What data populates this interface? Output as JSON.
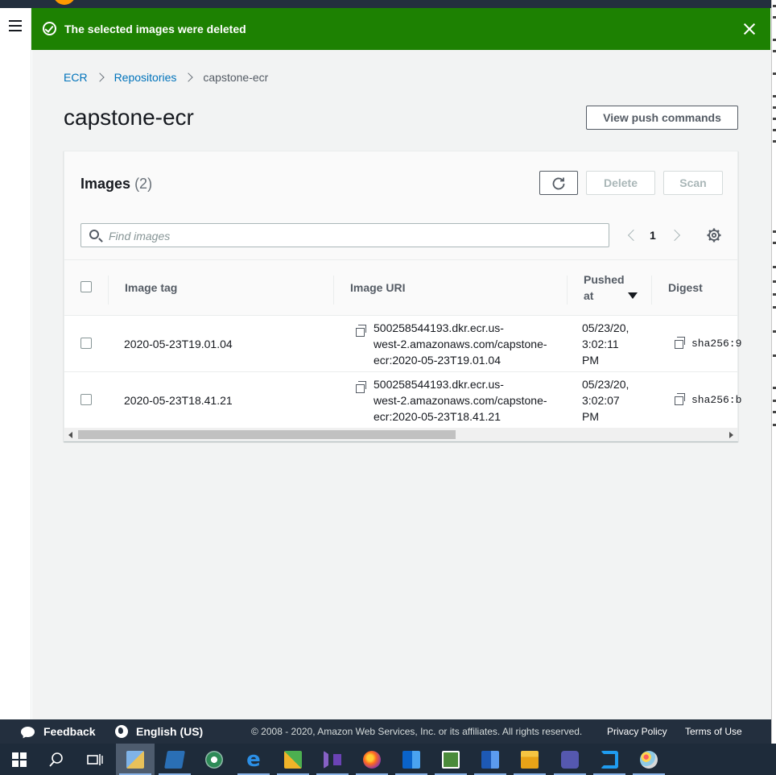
{
  "flash": {
    "message": "The selected images were deleted"
  },
  "breadcrumb": {
    "items": [
      "ECR",
      "Repositories",
      "capstone-ecr"
    ]
  },
  "page": {
    "title": "capstone-ecr",
    "push_button": "View push commands"
  },
  "panel": {
    "title": "Images",
    "count": "(2)",
    "delete_label": "Delete",
    "scan_label": "Scan",
    "search_placeholder": "Find images",
    "page_number": "1"
  },
  "table": {
    "headers": {
      "tag": "Image tag",
      "uri": "Image URI",
      "pushed_1": "Pushed",
      "pushed_2": "at",
      "digest": "Digest"
    },
    "rows": [
      {
        "tag": "2020-05-23T19.01.04",
        "uri": [
          "500258544193.dkr.ecr.us-",
          "west-2.amazonaws.com/capstone-",
          "ecr:2020-05-23T19.01.04"
        ],
        "pushed": [
          "05/23/20,",
          "3:02:11",
          "PM"
        ],
        "digest": "sha256:9"
      },
      {
        "tag": "2020-05-23T18.41.21",
        "uri": [
          "500258544193.dkr.ecr.us-",
          "west-2.amazonaws.com/capstone-",
          "ecr:2020-05-23T18.41.21"
        ],
        "pushed": [
          "05/23/20,",
          "3:02:07",
          "PM"
        ],
        "digest": "sha256:b"
      }
    ]
  },
  "footer": {
    "feedback": "Feedback",
    "language": "English (US)",
    "copyright": "© 2008 - 2020, Amazon Web Services, Inc. or its affiliates. All rights reserved.",
    "privacy": "Privacy Policy",
    "terms": "Terms of Use"
  },
  "taskbar": {
    "icons": [
      "windows-start-icon",
      "search-icon",
      "task-view-icon",
      "remote-desktop-icon",
      "powershell-icon",
      "chrome-like-icon",
      "edge-icon",
      "connector-icon",
      "visual-studio-icon",
      "firefox-icon",
      "outlook-icon",
      "project-icon",
      "word-icon",
      "file-explorer-icon",
      "teams-icon",
      "vscode-icon",
      "paint-icon"
    ]
  },
  "colors": {
    "success": "#1d8102",
    "link": "#0073bb",
    "aws_dark": "#232f3e",
    "taskbar": "#1e2b3a"
  }
}
